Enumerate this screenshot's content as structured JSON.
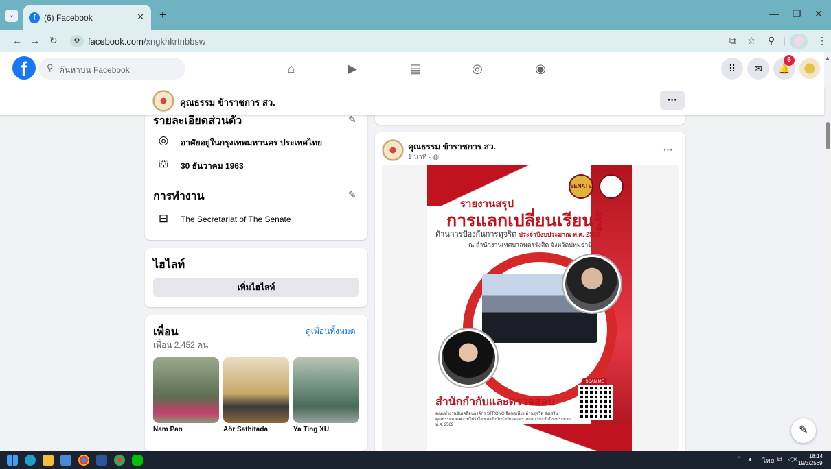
{
  "browser": {
    "tab_title": "(6) Facebook",
    "url_host": "facebook.com",
    "url_path": "/xngkhkrtnbbsw"
  },
  "fb": {
    "search_placeholder": "ค้นหาบน Facebook",
    "notification_count": "6",
    "profile_name": "คุณธรรม ข้าราชการ สว."
  },
  "about": {
    "heading": "รายละเอียดส่วนตัว",
    "location": "อาศัยอยู่ในกรุงเทพมหานคร ประเทศไทย",
    "birthday": "30 ธันวาคม 1963",
    "work_heading": "การทำงาน",
    "workplace": "The Secretariat of The Senate"
  },
  "highlights": {
    "heading": "ไฮไลท์",
    "add_button": "เพิ่มไฮไลท์"
  },
  "friends": {
    "heading": "เพื่อน",
    "see_all": "ดูเพื่อนทั้งหมด",
    "count_text": "เพื่อน 2,452 คน",
    "items": [
      {
        "name": "Nam Pan",
        "color": "#8a9a7a"
      },
      {
        "name": "Aör Sathitada",
        "color": "#c9a86a"
      },
      {
        "name": "Ya Ting XU",
        "color": "#6a8a7a"
      }
    ]
  },
  "post": {
    "author": "คุณธรรม ข้าราชการ สว.",
    "time": "1 นาที · ◍",
    "poster": {
      "logo_text": "SENATE STRONG",
      "subtitle": "รายงานสรุป",
      "title": "การแลกเปลี่ยนเรียนรู้",
      "line1_prefix": "ด้านการป้องกันการทุจริต",
      "line1_bold": "ประจำปีงบประมาณ พ.ศ. 2569",
      "line2": "ณ สำนักงานเทศบาลนครรังสิต จังหวัดปทุมธานี",
      "office": "สำนักกำกับและตรวจสอบ",
      "scan": "SCAN ME",
      "small_text": "คณะทำงานขับเคลื่อนองค์กร STRONG จิตพอเพียง ต้านทุจริต ส่งเสริมคุณธรรมและความโปร่งใส ของสำนักกำกับและตรวจสอบ ประจำปีงบประมาณ พ.ศ. 2569"
    }
  },
  "taskbar": {
    "lang": "ไทย",
    "time": "18:14",
    "date": "19/3/2569"
  }
}
